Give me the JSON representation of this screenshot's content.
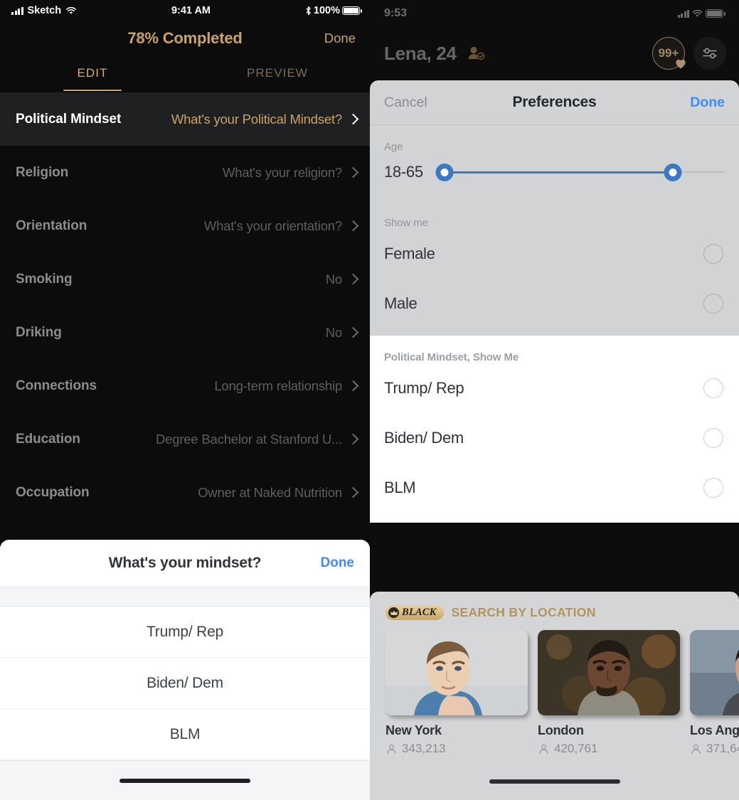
{
  "left": {
    "status_bar": {
      "carrier": "Sketch",
      "time": "9:41 AM",
      "battery_percent": "100%",
      "signal_icon": "signal-bars-icon",
      "wifi_icon": "wifi-icon",
      "bluetooth_icon": "bluetooth-icon",
      "battery_icon": "battery-full-icon"
    },
    "nav": {
      "title": "78% Completed",
      "done_label": "Done"
    },
    "tabs": [
      {
        "label": "EDIT",
        "active": true
      },
      {
        "label": "PREVIEW",
        "active": false
      }
    ],
    "profile_rows": [
      {
        "label": "Political Mindset",
        "value": "What's your Political Mindset?",
        "highlight": true
      },
      {
        "label": "Religion",
        "value": "What's your religion?",
        "highlight": false
      },
      {
        "label": "Orientation",
        "value": "What's your orientation?",
        "highlight": false
      },
      {
        "label": "Smoking",
        "value": "No",
        "highlight": false
      },
      {
        "label": "Driking",
        "value": "No",
        "highlight": false
      },
      {
        "label": "Connections",
        "value": "Long-term relationship",
        "highlight": false
      },
      {
        "label": "Education",
        "value": "Degree Bachelor at Stanford U...",
        "highlight": false
      },
      {
        "label": "Occupation",
        "value": "Owner at Naked Nutrition",
        "highlight": false
      }
    ],
    "mindset_sheet": {
      "title": "What's your mindset?",
      "done_label": "Done",
      "options": [
        {
          "label": "Trump/ Rep"
        },
        {
          "label": "Biden/ Dem"
        },
        {
          "label": "BLM"
        }
      ]
    }
  },
  "right": {
    "status_bar": {
      "time": "9:53",
      "signal_icon": "signal-bars-icon",
      "wifi_icon": "wifi-icon",
      "battery_icon": "battery-full-icon"
    },
    "header": {
      "name_age": "Lena, 24",
      "verified_icon": "verified-user-icon",
      "likes_badge": "99+",
      "heart_icon": "heart-icon",
      "filter_icon": "sliders-filter-icon"
    },
    "preferences": {
      "cancel_label": "Cancel",
      "title": "Preferences",
      "done_label": "Done",
      "age_section_label": "Age",
      "age_value": "18-65",
      "age_min": 18,
      "age_max": 65,
      "age_range_start_percent": 3,
      "age_range_end_percent": 82,
      "show_me_label": "Show me",
      "show_me_options": [
        {
          "label": "Female",
          "selected": false
        },
        {
          "label": "Male",
          "selected": false
        }
      ],
      "political_label": "Political Mindset, Show Me",
      "political_options": [
        {
          "label": "Trump/ Rep",
          "selected": false
        },
        {
          "label": "Biden/ Dem",
          "selected": false
        },
        {
          "label": "BLM",
          "selected": false
        }
      ]
    },
    "location": {
      "badge_label": "BLACK",
      "crown_icon": "crown-icon",
      "heading": "SEARCH BY LOCATION",
      "cities": [
        {
          "name": "New York",
          "count": "343,213",
          "people_icon": "people-icon"
        },
        {
          "name": "London",
          "count": "420,761",
          "people_icon": "people-icon"
        },
        {
          "name": "Los Ang",
          "count": "371,64",
          "people_icon": "people-icon"
        }
      ]
    }
  },
  "colors": {
    "gold_accent": "#c9a368",
    "gold_text": "#d4ad77",
    "dark_bg": "#0c0c0c",
    "row_highlight": "#1f2022",
    "ios_blue": "#3d8bfd",
    "slider_blue": "#3b78c4",
    "sheet_grey": "#d2d3d5"
  }
}
